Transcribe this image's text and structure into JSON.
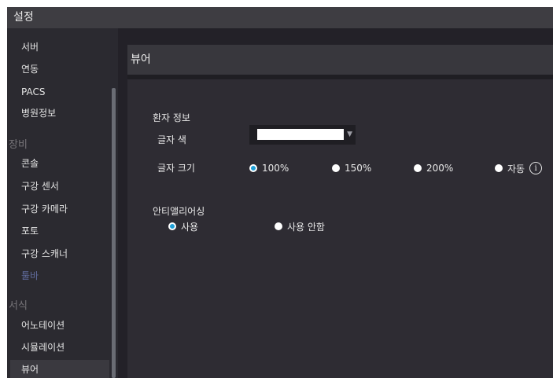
{
  "window": {
    "title": "설정"
  },
  "sidebar": {
    "items": [
      {
        "label": "서버"
      },
      {
        "label": "연동"
      },
      {
        "label": "PACS"
      },
      {
        "label": "병원정보"
      }
    ],
    "categories": [
      {
        "label": "장비",
        "items": [
          {
            "label": "콘솔"
          },
          {
            "label": "구강 센서"
          },
          {
            "label": "구강 카메라"
          },
          {
            "label": "포토"
          },
          {
            "label": "구강 스캐너"
          },
          {
            "label": "툴바",
            "state": "disabled"
          }
        ]
      },
      {
        "label": "서식",
        "items": [
          {
            "label": "어노테이션"
          },
          {
            "label": "시뮬레이션"
          },
          {
            "label": "뷰어",
            "state": "selected"
          }
        ]
      }
    ]
  },
  "panel": {
    "title": "뷰어",
    "patient_info": {
      "section_label": "환자 정보",
      "text_color": {
        "label": "글자 색",
        "value_color": "#ffffff",
        "dropdown_icon": "triangle-down"
      },
      "text_size": {
        "label": "글자 크기",
        "options": [
          {
            "label": "100%",
            "checked": true
          },
          {
            "label": "150%",
            "checked": false
          },
          {
            "label": "200%",
            "checked": false
          },
          {
            "label": "자동",
            "checked": false
          }
        ],
        "info_icon": "info-circle",
        "info_glyph": "i"
      }
    },
    "antialiasing": {
      "section_label": "안티앨리어싱",
      "options": [
        {
          "label": "사용",
          "checked": true
        },
        {
          "label": "사용 안함",
          "checked": false
        }
      ]
    }
  },
  "colors": {
    "radio_checked": "#1e9fd6",
    "disabled_text": "#5f6a9a",
    "background": "#2e2c33"
  }
}
